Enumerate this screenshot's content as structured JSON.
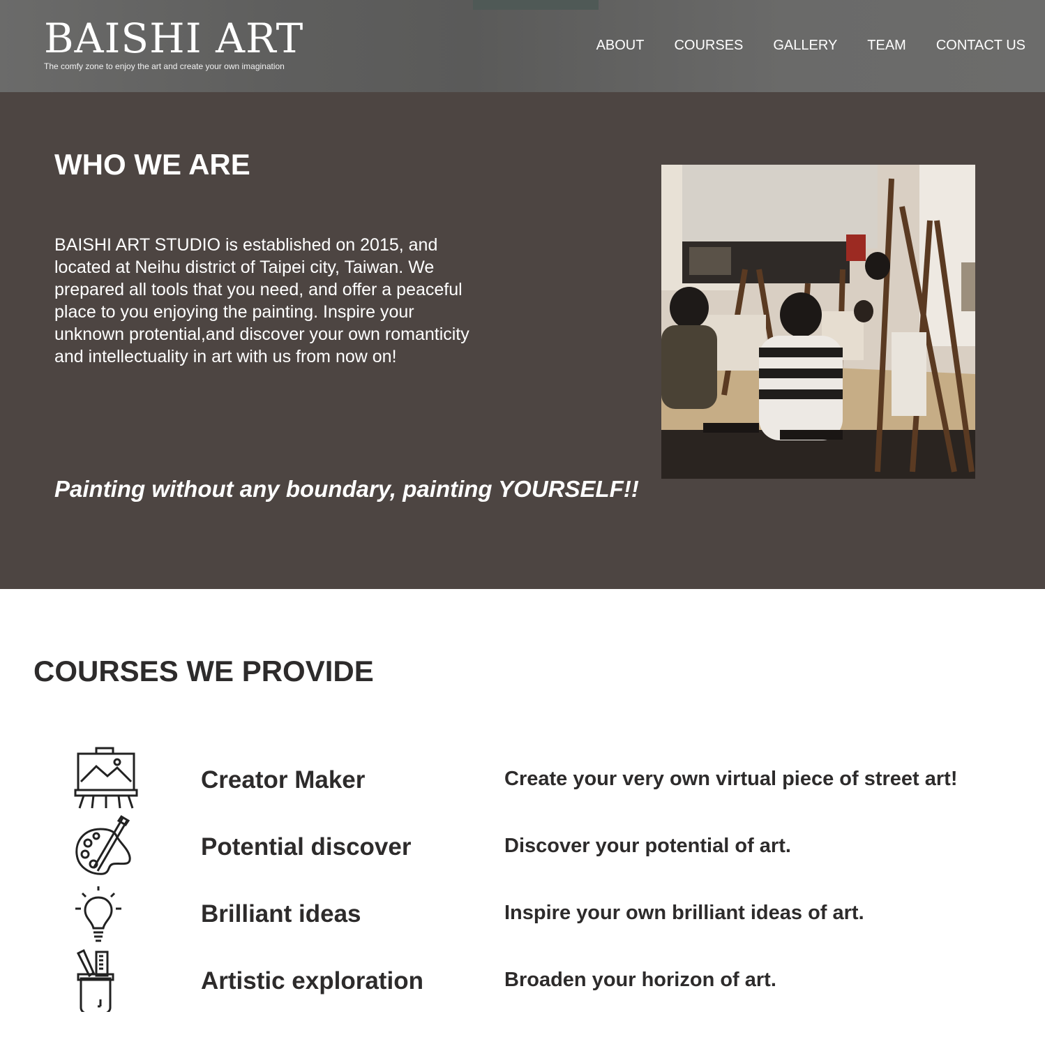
{
  "header": {
    "logo_title": "BAISHI ART",
    "tagline": "The comfy zone to enjoy the art and create your own imagination",
    "nav": [
      {
        "label": "ABOUT"
      },
      {
        "label": "COURSES"
      },
      {
        "label": "GALLERY"
      },
      {
        "label": "TEAM"
      },
      {
        "label": "CONTACT US"
      }
    ]
  },
  "about": {
    "title": "WHO WE ARE",
    "body": "BAISHI ART STUDIO is established on 2015, and located at Neihu district of Taipei city, Taiwan. We prepared all tools that you need, and offer a peaceful place to you enjoying the painting. Inspire your unknown protential,and discover your own romanticity and intellectuality in art with us from now on!",
    "slogan": "Painting without any boundary, painting YOURSELF!!"
  },
  "courses": {
    "title": "COURSES WE PROVIDE",
    "items": [
      {
        "icon": "easel-icon",
        "name": "Creator Maker",
        "description": "Create your very own virtual piece of street art!"
      },
      {
        "icon": "palette-brush-icon",
        "name": "Potential discover",
        "description": "Discover your potential of art."
      },
      {
        "icon": "lightbulb-icon",
        "name": "Brilliant ideas",
        "description": "Inspire your own brilliant ideas of art."
      },
      {
        "icon": "brush-cup-icon",
        "name": "Artistic exploration",
        "description": "Broaden your horizon of art."
      }
    ]
  },
  "colors": {
    "about_background": "#4d4542",
    "header_background": "#636362",
    "heading_dark": "#2d2b2b"
  }
}
